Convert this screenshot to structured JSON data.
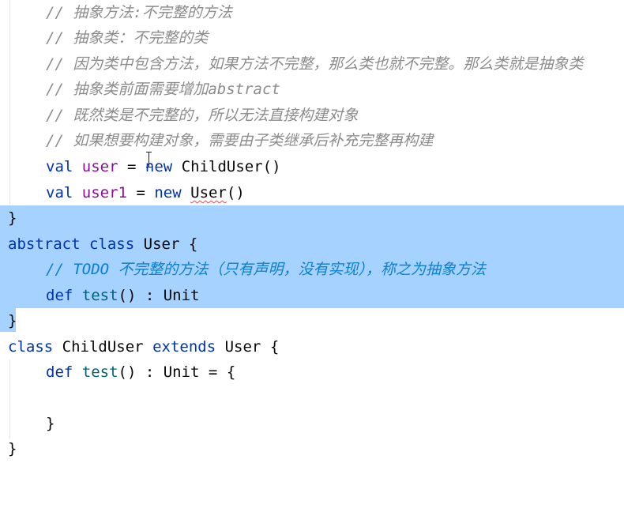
{
  "editor": {
    "comment_prefix": "// ",
    "lines": {
      "c1": "抽象方法:不完整的方法",
      "c2": "抽象类：不完整的类",
      "c3": "因为类中包含方法，如果方法不完整，那么类也就不完整。那么类就是抽象类",
      "c4": "抽象类前面需要增加abstract",
      "c5": "既然类是不完整的，所以无法直接构建对象",
      "c6": "如果想要构建对象，需要由子类继承后补充完整再构建",
      "val1": {
        "kw": "val",
        "name": "user",
        "eq": "=",
        "kw2": "new",
        "cls": "ChildUser",
        "parens": "()"
      },
      "val2": {
        "kw": "val",
        "name": "user1",
        "eq": "=",
        "kw2": "new",
        "cls": "User",
        "parens": "()"
      },
      "brace_close": "}",
      "abs_decl": {
        "kw1": "abstract",
        "kw2": "class",
        "name": "User",
        "brace": "{"
      },
      "todo_prefix": "// ",
      "todo_tag": "TODO",
      "todo_text": "不完整的方法（只有声明，没有实现），称之为抽象方法",
      "def1": {
        "kw": "def",
        "fn": "test",
        "sig": "() : Unit"
      },
      "child_decl": {
        "kw1": "class",
        "name": "ChildUser",
        "kw2": "extends",
        "parent": "User",
        "brace": "{"
      },
      "def2": {
        "kw": "def",
        "fn": "test",
        "sig": "() : Unit = {"
      },
      "inner_close": "}",
      "outer_close": "}"
    }
  }
}
